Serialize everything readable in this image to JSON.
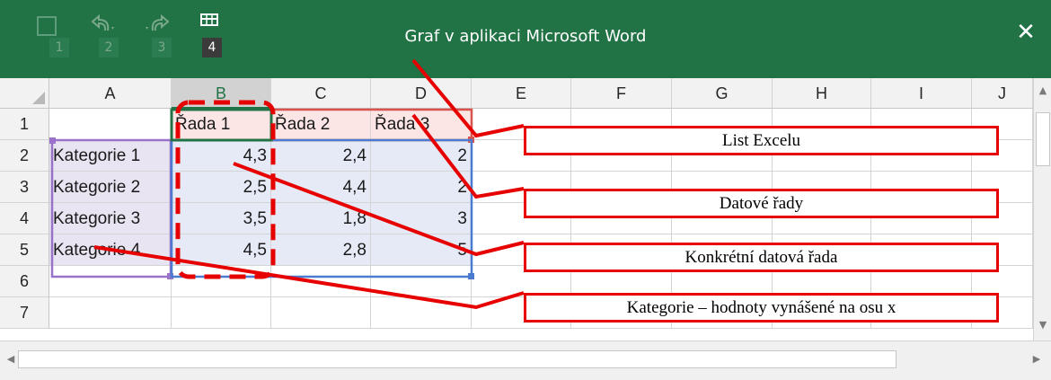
{
  "window": {
    "title": "Graf v aplikaci Microsoft Word",
    "close_label": "✕"
  },
  "quick_access": {
    "badges": [
      "1",
      "2",
      "3",
      "4"
    ]
  },
  "sheet": {
    "columns": [
      "A",
      "B",
      "C",
      "D",
      "E",
      "F",
      "G",
      "H",
      "I",
      "J"
    ],
    "rows": [
      "1",
      "2",
      "3",
      "4",
      "5",
      "6",
      "7"
    ],
    "series_headers": [
      "Řada 1",
      "Řada 2",
      "Řada 3"
    ],
    "categories": [
      "Kategorie 1",
      "Kategorie 2",
      "Kategorie 3",
      "Kategorie 4"
    ],
    "values": [
      [
        "4,3",
        "2,4",
        "2"
      ],
      [
        "2,5",
        "4,4",
        "2"
      ],
      [
        "3,5",
        "1,8",
        "3"
      ],
      [
        "4,5",
        "2,8",
        "5"
      ]
    ]
  },
  "callouts": [
    "List Excelu",
    "Datové řady",
    "Konkrétní datová řada",
    "Kategorie – hodnoty vynášené na osu x"
  ],
  "colors": {
    "titlebar": "#217346",
    "annotation": "#e60000",
    "category_range": "#9b72c9",
    "series_range": "#d9534f",
    "values_range": "#4a7bd0"
  }
}
